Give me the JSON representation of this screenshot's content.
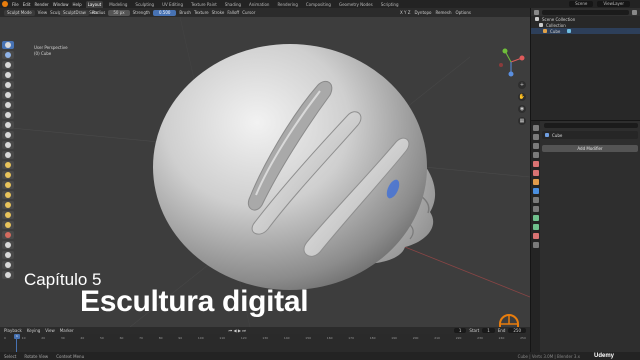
{
  "topbar": {
    "menu": [
      "File",
      "Edit",
      "Render",
      "Window",
      "Help"
    ],
    "tabs": [
      "Layout",
      "Modeling",
      "Sculpting",
      "UV Editing",
      "Texture Paint",
      "Shading",
      "Animation",
      "Rendering",
      "Compositing",
      "Geometry Nodes",
      "Scripting"
    ],
    "active_tab": "Layout",
    "scene": "Scene",
    "view_layer": "ViewLayer"
  },
  "header": {
    "mode": "Sculpt Mode",
    "view": "View",
    "sculpt": "Sculpt",
    "mask": "Mask",
    "face_sets": "Face Sets",
    "brush_name": "SculptDraw",
    "radius_label": "Radius",
    "radius_value": "50 px",
    "strength_label": "Strength",
    "strength_value": "0.500",
    "brush": "Brush",
    "texture": "Texture",
    "stroke": "Stroke",
    "falloff": "Falloff",
    "cursor": "Cursor",
    "dyntopo": "Dyntopo",
    "remesh": "Remesh",
    "options": "Options",
    "symmetry": "X Y Z"
  },
  "viewport": {
    "view_name": "User Perspective",
    "object_label": "(0) Cube"
  },
  "overlay": {
    "chapter": "Capítulo 5",
    "title": "Escultura digital"
  },
  "timeline": {
    "playback": "Playback",
    "keying": "Keying",
    "view": "View",
    "marker": "Marker",
    "current_frame": "1",
    "start_label": "Start",
    "start_value": "1",
    "end_label": "End",
    "end_value": "250",
    "ticks": [
      "0",
      "10",
      "20",
      "30",
      "40",
      "50",
      "60",
      "70",
      "80",
      "90",
      "100",
      "110",
      "120",
      "130",
      "140",
      "150",
      "160",
      "170",
      "180",
      "190",
      "200",
      "210",
      "220",
      "230",
      "240",
      "250"
    ]
  },
  "statusbar": {
    "items": [
      "Select",
      "Rotate View",
      "Context Menu"
    ],
    "version": "Cube | Verts 3.0M | Blender 3.x"
  },
  "outliner": {
    "rows": [
      "Scene Collection",
      "Collection",
      "Cube"
    ]
  },
  "properties": {
    "object_name": "Cube",
    "add_modifier": "Add Modifier"
  },
  "watermark": "Udemy",
  "colors": {
    "accent": "#4772b3",
    "viewport_bg": "#3d3d3d",
    "panel_bg": "#2e2e2e"
  }
}
